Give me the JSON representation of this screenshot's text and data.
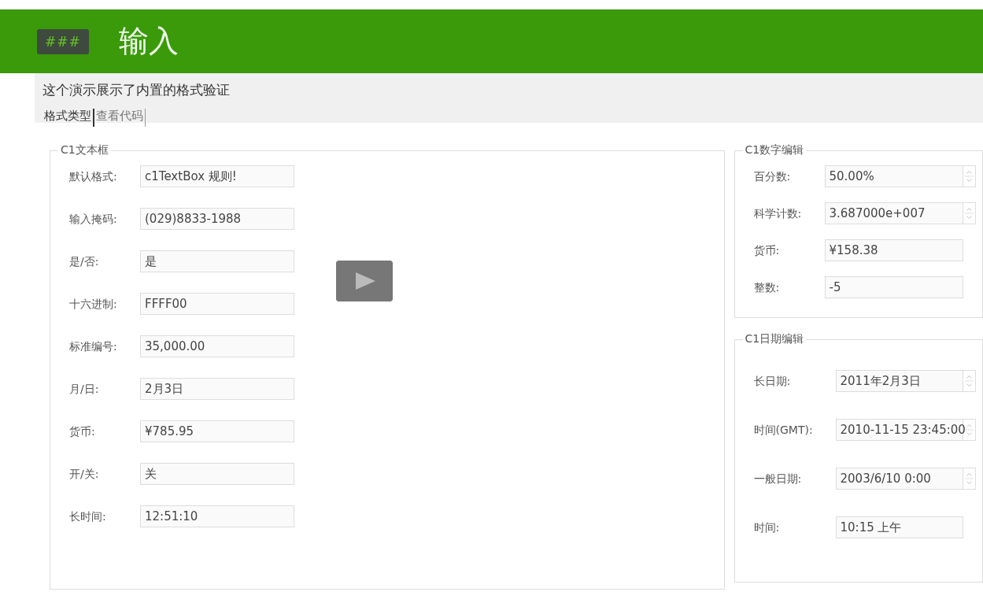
{
  "header": {
    "logo": "###",
    "title": "输入"
  },
  "description": "这个演示展示了内置的格式验证",
  "tabs": [
    {
      "label": "格式类型",
      "selected": true
    },
    {
      "label": "查看代码",
      "selected": false
    }
  ],
  "left_panel": {
    "title": "C1文本框",
    "fields": [
      {
        "label": "默认格式:",
        "value": "c1TextBox 规则!",
        "kind": "text"
      },
      {
        "label": "输入掩码:",
        "value": "(029)8833-1988",
        "kind": "text"
      },
      {
        "label": "是/否:",
        "value": "是",
        "kind": "text"
      },
      {
        "label": "十六进制:",
        "value": "FFFF00",
        "kind": "text"
      },
      {
        "label": "标准编号:",
        "value": "35,000.00",
        "kind": "text"
      },
      {
        "label": "月/日:",
        "value": "2月3日",
        "kind": "text"
      },
      {
        "label": "货币:",
        "value": "¥785.95",
        "kind": "text"
      },
      {
        "label": "开/关:",
        "value": "关",
        "kind": "text"
      },
      {
        "label": "长时间:",
        "value": "12:51:10",
        "kind": "text"
      }
    ]
  },
  "right_panels": [
    {
      "title": "C1数字编辑",
      "fields": [
        {
          "label": "百分数:",
          "value": "50.00%",
          "kind": "spin"
        },
        {
          "label": "科学计数:",
          "value": "3.687000e+007",
          "kind": "spin"
        },
        {
          "label": "货币:",
          "value": "¥158.38",
          "kind": "text"
        },
        {
          "label": "整数:",
          "value": "-5",
          "kind": "text"
        }
      ]
    },
    {
      "title": "C1日期编辑",
      "fields": [
        {
          "label": "长日期:",
          "value": "2011年2月3日",
          "kind": "spin"
        },
        {
          "label": "时间(GMT):",
          "value": "2010-11-15 23:45:00",
          "kind": "spin"
        },
        {
          "label": "一般日期:",
          "value": "2003/6/10 0:00",
          "kind": "spin"
        },
        {
          "label": "时间:",
          "value": "10:15 上午",
          "kind": "text"
        }
      ]
    }
  ]
}
